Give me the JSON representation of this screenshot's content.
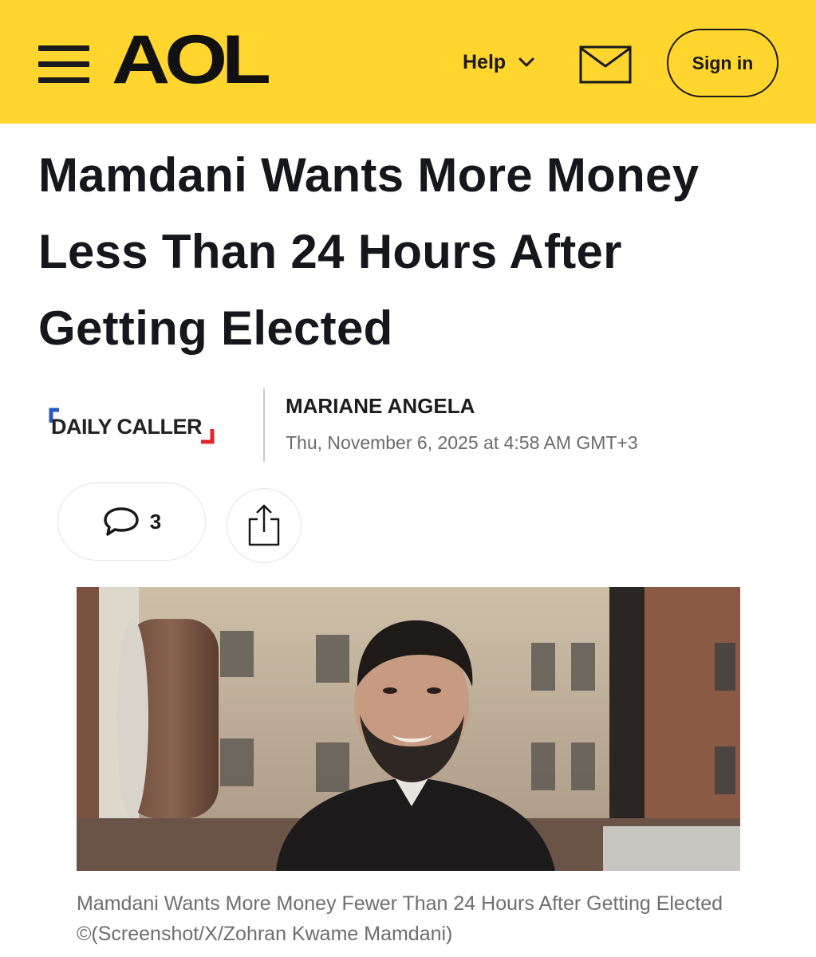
{
  "header": {
    "logo_text": "AOL",
    "help_label": "Help",
    "signin_label": "Sign in",
    "background_color": "#ffd52e"
  },
  "icons": {
    "menu": "hamburger-menu-icon",
    "help_dropdown": "chevron-down-icon",
    "mail": "envelope-icon",
    "comments": "speech-bubble-icon",
    "share": "share-icon"
  },
  "article": {
    "headline_line1": "Mamdani Wants More Money",
    "headline_line2": "Less Than 24 Hours After",
    "headline_line3": "Getting Elected",
    "publisher": "DAILY CALLER",
    "author": "MARIANE ANGELA",
    "published": "Thu, November 6, 2025 at 4:58 AM GMT+3",
    "comment_count": "3",
    "image_caption": "Mamdani Wants More Money Fewer Than 24 Hours After Getting Elected ©(Screenshot/X/Zohran Kwame Mamdani)"
  },
  "colors": {
    "publisher_accent_blue": "#2b59c3",
    "publisher_accent_red": "#e0262b"
  }
}
